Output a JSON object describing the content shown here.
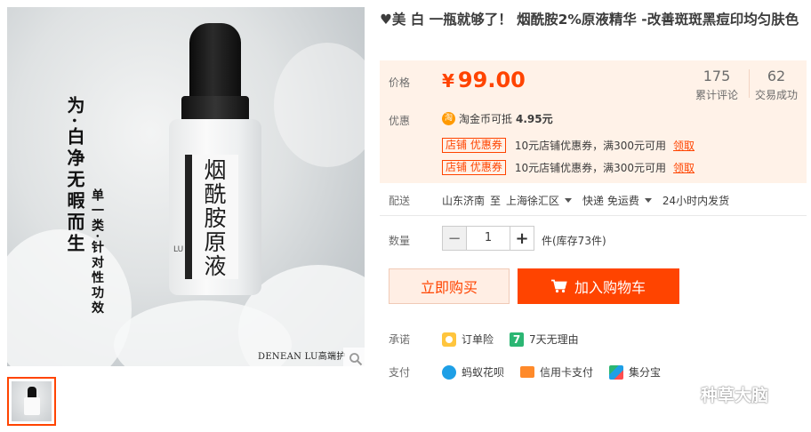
{
  "product": {
    "title": "♥美 白 一瓶就够了！ 烟酰胺2%原液精华 -改善斑斑黑痘印均匀肤色",
    "image": {
      "slogan_line1": "为·白净无暇而生",
      "slogan_line2": "单一类·针对性功效",
      "bottle_label": "烟酰胺原液",
      "bottle_side_text": "LU",
      "brand_caption": "DENEAN LU高端护"
    }
  },
  "price": {
    "label": "价格",
    "currency": "¥",
    "value": "99.00",
    "accent_color": "#ff4400"
  },
  "stats": [
    {
      "count": "175",
      "label": "累计评论"
    },
    {
      "count": "62",
      "label": "交易成功"
    }
  ],
  "promo": {
    "label": "优惠",
    "coin_icon_text": "淘",
    "coin_text": "淘金币可抵",
    "coin_amount": "4.95元",
    "coupons": [
      {
        "tag": "店铺 优惠券",
        "text": "10元店铺优惠券，满300元可用",
        "link": "领取"
      },
      {
        "tag": "店铺 优惠券",
        "text": "10元店铺优惠券，满300元可用",
        "link": "领取"
      }
    ]
  },
  "delivery": {
    "label": "配送",
    "from": "山东济南",
    "to_word": "至",
    "to": "上海徐汇区",
    "shipping": "快递 免运费",
    "dispatch": "24小时内发货"
  },
  "quantity": {
    "label": "数量",
    "minus": "−",
    "value": "1",
    "plus": "+",
    "stock_text": "件(库存73件)"
  },
  "actions": {
    "buy_now": "立即购买",
    "add_to_cart": "加入购物车"
  },
  "promise": {
    "label": "承诺",
    "items": [
      {
        "icon": "shield-icon",
        "text": "订单险"
      },
      {
        "icon": "seven-days-icon",
        "icon_text": "7",
        "text": "7天无理由"
      }
    ]
  },
  "payment": {
    "label": "支付",
    "items": [
      {
        "icon": "huabei-icon",
        "text": "蚂蚁花呗"
      },
      {
        "icon": "credit-card-icon",
        "text": "信用卡支付"
      },
      {
        "icon": "jifenbao-icon",
        "text": "集分宝"
      }
    ]
  },
  "watermark": {
    "text": "种草大脑"
  }
}
